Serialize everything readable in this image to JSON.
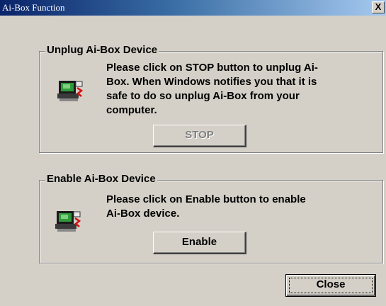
{
  "window": {
    "title": "Ai-Box Function",
    "close_glyph": "X"
  },
  "unplug_group": {
    "legend": "Unplug Ai-Box Device",
    "description": "Please click on STOP button to unplug Ai-Box. When Windows notifies you that it is safe to do so unplug Ai-Box from your computer.",
    "icon": "device-icon",
    "button_label": "STOP",
    "button_state": "disabled"
  },
  "enable_group": {
    "legend": "Enable Ai-Box Device",
    "description": "Please click on Enable button to enable Ai-Box device.",
    "icon": "device-icon",
    "button_label": "Enable"
  },
  "close_button": {
    "label": "Close"
  },
  "colors": {
    "face": "#d4d0c8",
    "titlebar_start": "#0a246a",
    "titlebar_end": "#a6caf0",
    "disabled_text": "#808080"
  }
}
